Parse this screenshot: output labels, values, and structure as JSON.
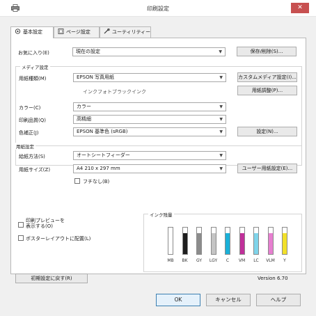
{
  "window": {
    "title": "印刷設定",
    "close_label": "✕"
  },
  "tabs": [
    {
      "label": "基本設定",
      "icon": "basic-settings-icon",
      "active": true
    },
    {
      "label": "ページ設定",
      "icon": "page-settings-icon",
      "active": false
    },
    {
      "label": "ユーティリティー",
      "icon": "utility-icon",
      "active": false
    }
  ],
  "favorites": {
    "label": "お気に入り(E)",
    "value": "現在の設定",
    "save_label": "保存/削除(S)..."
  },
  "media": {
    "group_title": "メディア設定",
    "paper_type_label": "用紙種類(M)",
    "paper_type_value": "EPSON 写真用紙",
    "custom_media_label": "カスタムメディア設定(I)...",
    "ink_mode_text": "インクフォトブラックインク",
    "paper_adjust_label": "用紙調整(P)...",
    "color_label": "カラー(C)",
    "color_value": "カラー",
    "quality_label": "印刷品質(Q)",
    "quality_value": "高精細",
    "color_correction_label": "色補正(J)",
    "color_correction_value": "EPSON 基準色 (sRGB)",
    "settings_label": "設定(N)..."
  },
  "paper": {
    "group_title": "用紙設定",
    "feed_label": "給紙方法(S)",
    "feed_value": "オートシートフィーダー",
    "size_label": "用紙サイズ(Z)",
    "size_value": "A4 210 x 297 mm",
    "user_paper_label": "ユーザー用紙設定(E)...",
    "borderless_label": "フチなし(B)"
  },
  "options": {
    "preview_label_1": "印刷プレビューを",
    "preview_label_2": "表示する(O)",
    "poster_layout_label": "ポスターレイアウトに配置(L)"
  },
  "ink_levels": {
    "group_title": "インク残量",
    "inks": [
      {
        "name": "MB",
        "color": "#1e1e1e",
        "level": 0
      },
      {
        "name": "BK",
        "color": "#1e1e1e",
        "level": 0.78
      },
      {
        "name": "GY",
        "color": "#8c8c8c",
        "level": 0.78
      },
      {
        "name": "LGY",
        "color": "#c4c4c4",
        "level": 0.78
      },
      {
        "name": "C",
        "color": "#1ab0d8",
        "level": 0.78
      },
      {
        "name": "VM",
        "color": "#c0309a",
        "level": 0.78
      },
      {
        "name": "LC",
        "color": "#7fd4ea",
        "level": 0.78
      },
      {
        "name": "VLM",
        "color": "#e77fd0",
        "level": 0.78
      },
      {
        "name": "Y",
        "color": "#f2e02a",
        "level": 0.78
      }
    ]
  },
  "restore_defaults_label": "初期設定に戻す(R)",
  "version": "Version 6.70",
  "buttons": {
    "ok": "OK",
    "cancel": "キャンセル",
    "help": "ヘルプ"
  }
}
